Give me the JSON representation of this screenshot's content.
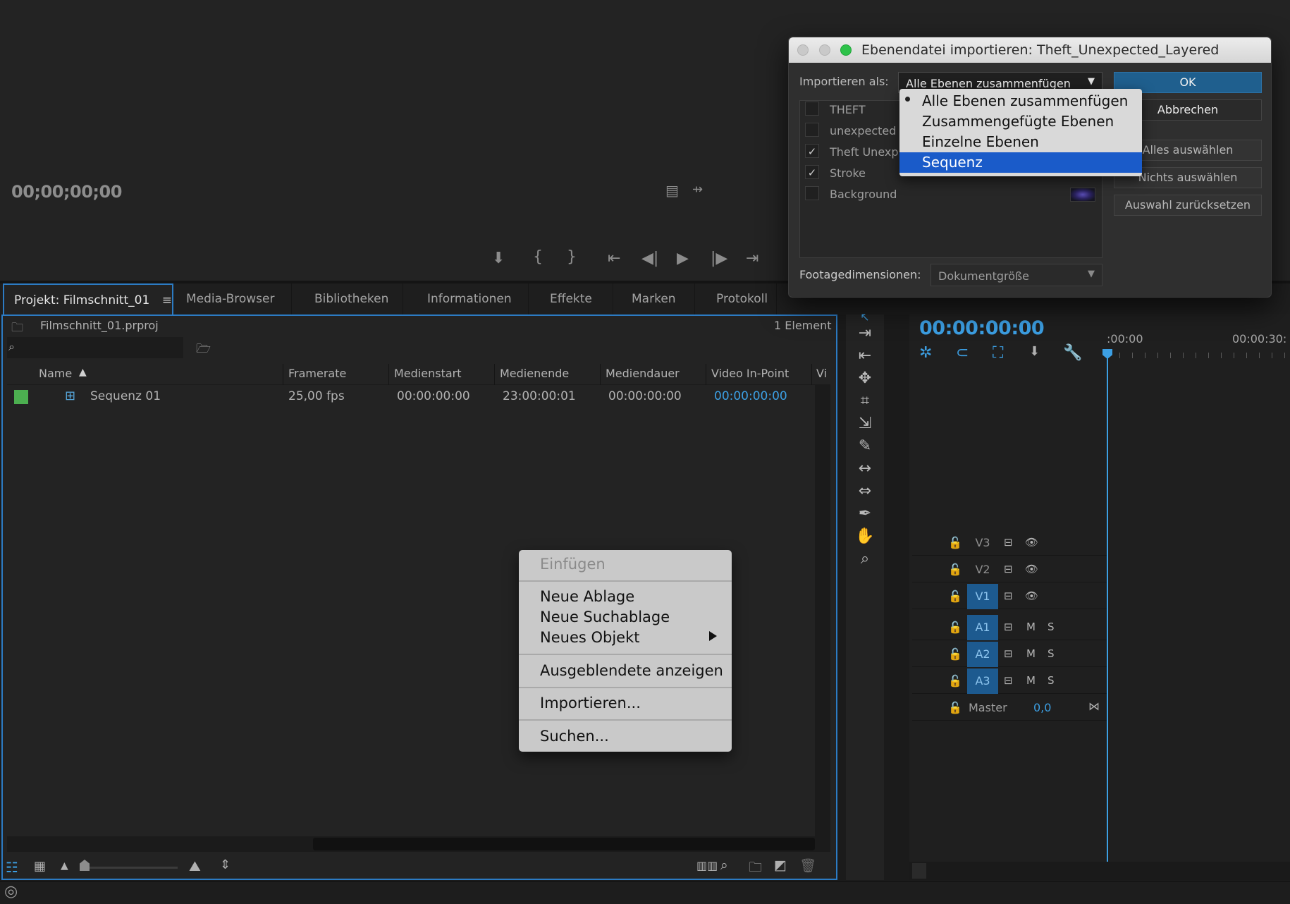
{
  "colors": {
    "accent": "#2c7bc3",
    "timecode_blue": "#3c9fe3",
    "label_green": "#4caf50",
    "dialog_ok": "#1f5f8e",
    "menu_selection": "#1a5bc9"
  },
  "monitor": {
    "timecode": "00;00;00;00",
    "controls": [
      "marker-icon",
      "mark-in-icon",
      "mark-out-icon",
      "go-to-in-icon",
      "step-back-icon",
      "play-icon",
      "step-forward-icon",
      "go-to-out-icon"
    ]
  },
  "tabs": [
    {
      "label": "Projekt: Filmschnitt_01",
      "active": true
    },
    {
      "label": "Media-Browser"
    },
    {
      "label": "Bibliotheken"
    },
    {
      "label": "Informationen"
    },
    {
      "label": "Effekte"
    },
    {
      "label": "Marken"
    },
    {
      "label": "Protokoll"
    }
  ],
  "project": {
    "menu_glyph": "≡",
    "filename": "Filmschnitt_01.prproj",
    "count": "1 Element",
    "columns": [
      "Name",
      "Framerate",
      "Medienstart",
      "Medienende",
      "Mediendauer",
      "Video In-Point",
      "Vi"
    ],
    "rows": [
      {
        "name": "Sequenz 01",
        "framerate": "25,00 fps",
        "start": "00:00:00:00",
        "end": "23:00:00:01",
        "duration": "00:00:00:00",
        "video_in": "00:00:00:00"
      }
    ]
  },
  "timeline": {
    "timecode": "00:00:00:00",
    "ruler": [
      ":00:00",
      "00:00:30:"
    ],
    "video_tracks": [
      "V3",
      "V2",
      "V1"
    ],
    "audio_tracks": [
      "A1",
      "A2",
      "A3"
    ],
    "audio_mute": "M",
    "audio_solo": "S",
    "master_label": "Master",
    "master_value": "0,0"
  },
  "dialog": {
    "title": "Ebenendatei importieren: Theft_Unexpected_Layered",
    "import_label": "Importieren als:",
    "import_value": "Alle Ebenen zusammenfügen",
    "layers": [
      {
        "label": "THEFT",
        "checked": false
      },
      {
        "label": "unexpected",
        "checked": false
      },
      {
        "label": "Theft Unexp",
        "checked": true
      },
      {
        "label": "Stroke",
        "checked": true
      },
      {
        "label": "Background",
        "checked": false
      }
    ],
    "buttons": {
      "ok": "OK",
      "cancel": "Abbrechen",
      "select_all": "Alles auswählen",
      "select_none": "Nichts auswählen",
      "reset": "Auswahl zurücksetzen"
    },
    "footage_label": "Footagedimensionen:",
    "footage_value": "Dokumentgröße",
    "popup_options": [
      {
        "label": "Alle Ebenen zusammenfügen",
        "current": true
      },
      {
        "label": "Zusammengefügte Ebenen"
      },
      {
        "label": "Einzelne Ebenen"
      },
      {
        "label": "Sequenz",
        "selected": true
      }
    ]
  },
  "context_menu": {
    "paste": "Einfügen",
    "new_bin": "Neue Ablage",
    "new_search_bin": "Neue Suchablage",
    "new_item": "Neues Objekt",
    "show_hidden": "Ausgeblendete anzeigen",
    "import": "Importieren...",
    "find": "Suchen..."
  }
}
